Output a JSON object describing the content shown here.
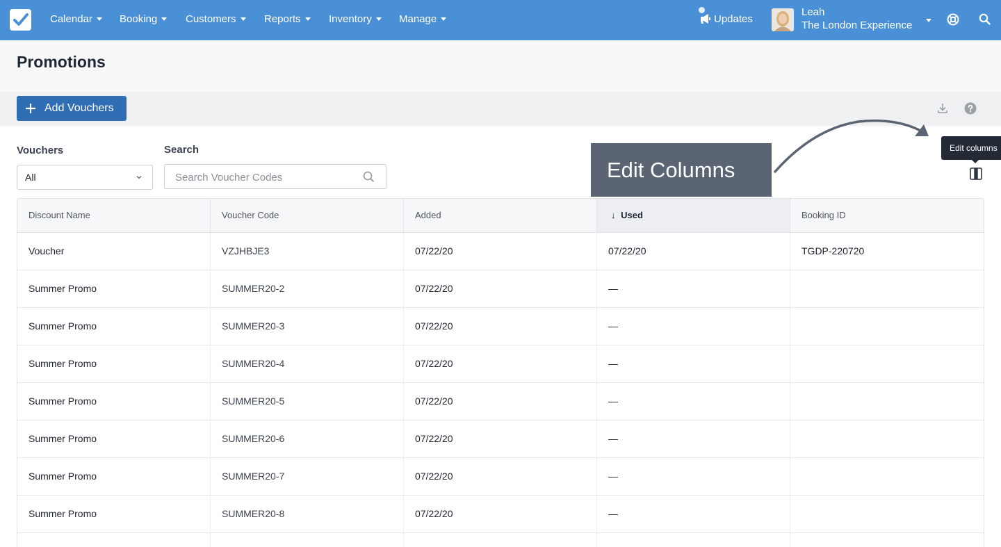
{
  "nav": {
    "items": [
      {
        "label": "Calendar"
      },
      {
        "label": "Booking"
      },
      {
        "label": "Customers"
      },
      {
        "label": "Reports"
      },
      {
        "label": "Inventory"
      },
      {
        "label": "Manage"
      }
    ],
    "updates_label": "Updates",
    "user_name": "Leah",
    "user_org": "The London Experience",
    "brand_color": "#4a90d6"
  },
  "page": {
    "title": "Promotions",
    "add_button_label": "Add Vouchers"
  },
  "filters": {
    "vouchers_label": "Vouchers",
    "vouchers_value": "All",
    "search_label": "Search",
    "search_placeholder": "Search Voucher Codes"
  },
  "annotation": {
    "callout_text": "Edit Columns",
    "tooltip_text": "Edit columns"
  },
  "table": {
    "columns": [
      "Discount Name",
      "Voucher Code",
      "Added",
      "Used",
      "Booking ID"
    ],
    "sorted_column": "Used",
    "sort_indicator": "↓",
    "rows": [
      {
        "name": "Voucher",
        "code": "VZJHBJE3",
        "added": "07/22/20",
        "used": "07/22/20",
        "booking_id": "TGDP-220720"
      },
      {
        "name": "Summer Promo",
        "code": "SUMMER20-2",
        "added": "07/22/20",
        "used": "—",
        "booking_id": ""
      },
      {
        "name": "Summer Promo",
        "code": "SUMMER20-3",
        "added": "07/22/20",
        "used": "—",
        "booking_id": ""
      },
      {
        "name": "Summer Promo",
        "code": "SUMMER20-4",
        "added": "07/22/20",
        "used": "—",
        "booking_id": ""
      },
      {
        "name": "Summer Promo",
        "code": "SUMMER20-5",
        "added": "07/22/20",
        "used": "—",
        "booking_id": ""
      },
      {
        "name": "Summer Promo",
        "code": "SUMMER20-6",
        "added": "07/22/20",
        "used": "—",
        "booking_id": ""
      },
      {
        "name": "Summer Promo",
        "code": "SUMMER20-7",
        "added": "07/22/20",
        "used": "—",
        "booking_id": ""
      },
      {
        "name": "Summer Promo",
        "code": "SUMMER20-8",
        "added": "07/22/20",
        "used": "—",
        "booking_id": ""
      }
    ]
  }
}
